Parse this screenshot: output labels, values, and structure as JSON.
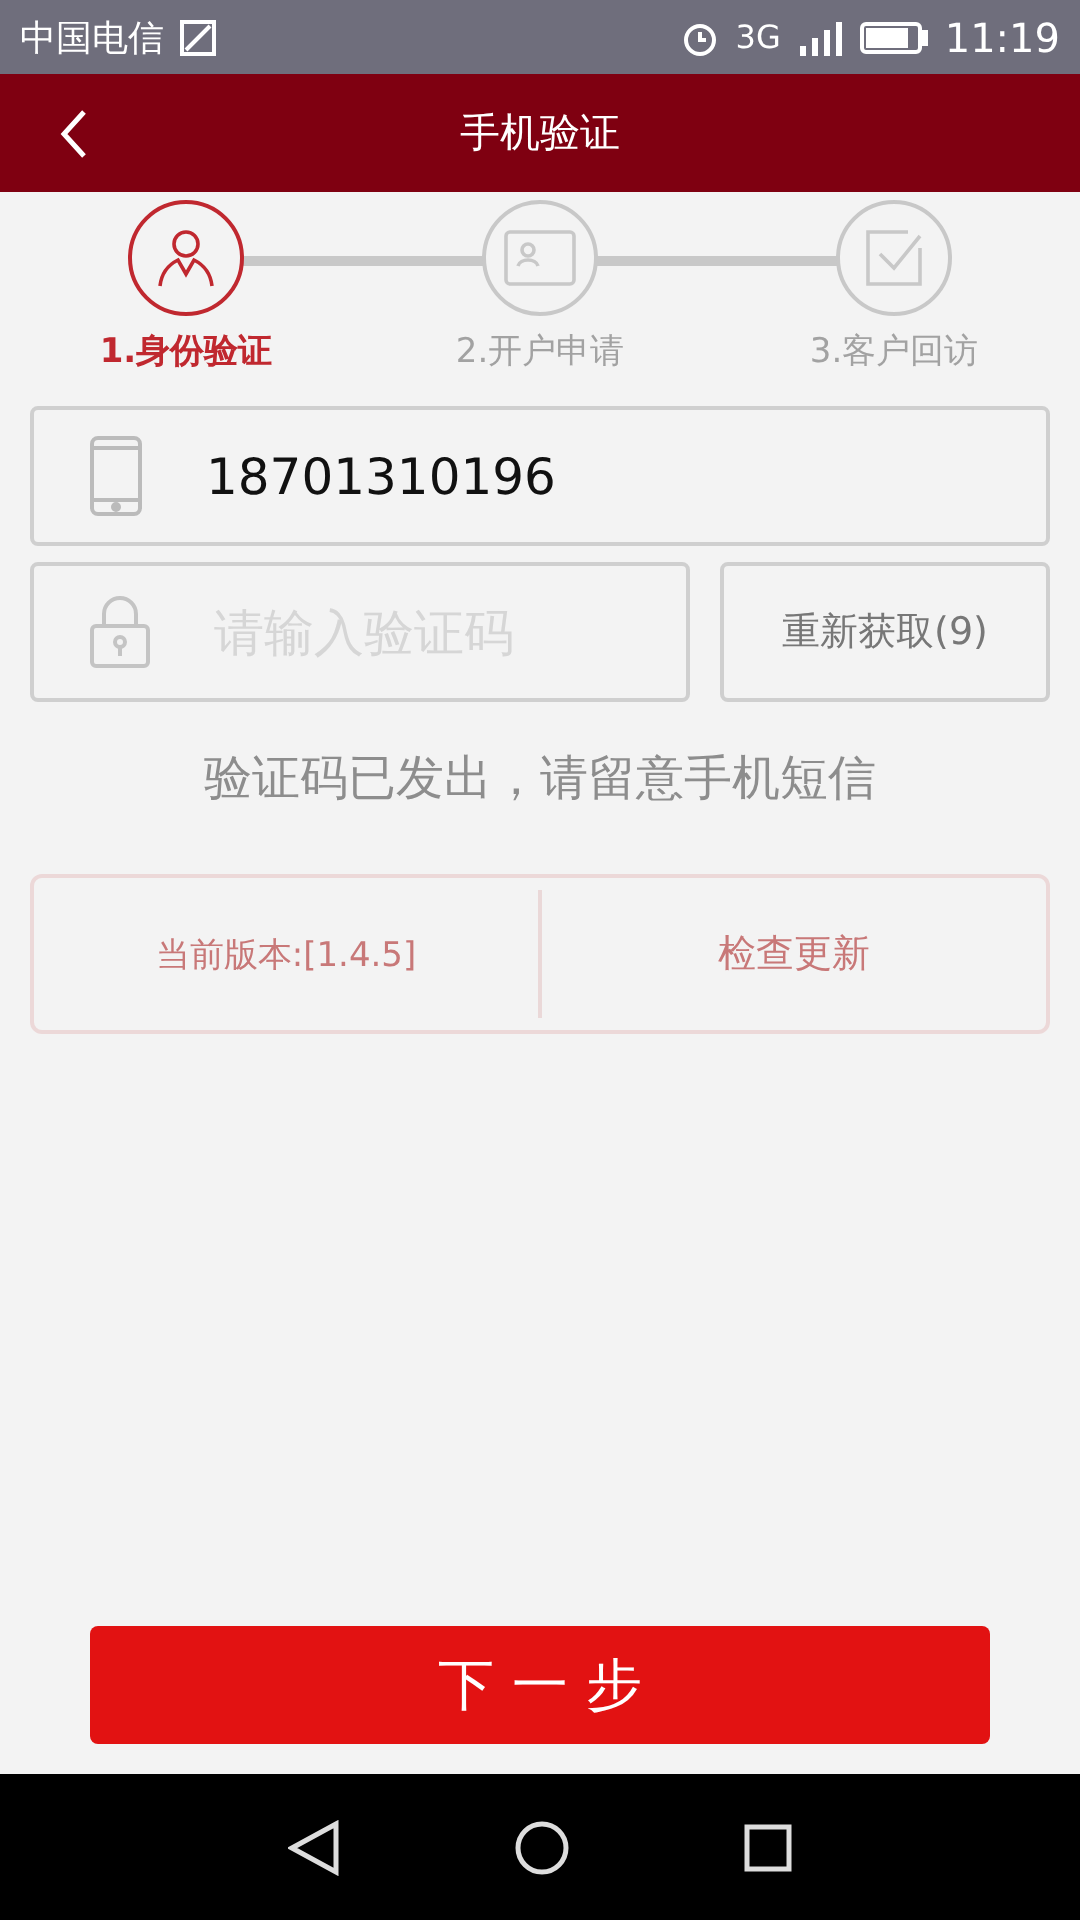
{
  "status_bar": {
    "carrier": "中国电信",
    "network": "3G",
    "time": "11:19"
  },
  "app_bar": {
    "title": "手机验证"
  },
  "steps": [
    {
      "label": "1.身份验证",
      "kind": "person",
      "selected": true
    },
    {
      "label": "2.开户申请",
      "kind": "card",
      "selected": false
    },
    {
      "label": "3.客户回访",
      "kind": "check",
      "selected": false
    }
  ],
  "phone_field": {
    "value": "18701310196"
  },
  "code_field": {
    "placeholder": "请输入验证码"
  },
  "resend_button": "重新获取(9)",
  "hint": "验证码已发出，请留意手机短信",
  "version_panel": {
    "version": "当前版本:[1.4.5]",
    "update_button": "检查更新"
  },
  "next_button": "下 一 步"
}
